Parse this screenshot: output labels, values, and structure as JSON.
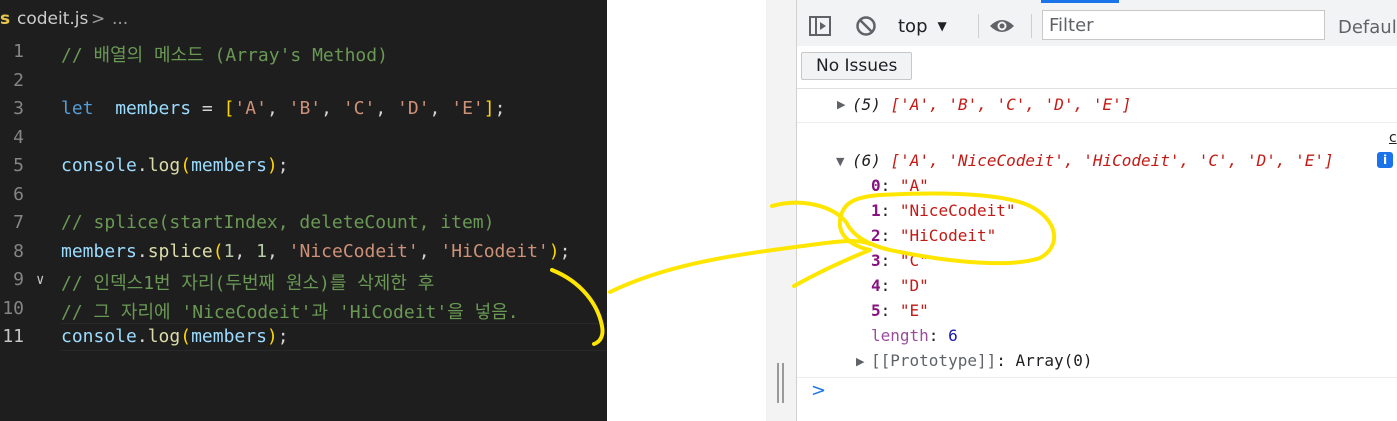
{
  "editor": {
    "tab_icon": "JS",
    "tab_file": "codeit.js",
    "tab_separator": ">",
    "tab_more": "...",
    "lines": [
      {
        "number": "1",
        "tokens": [
          [
            "cm",
            "// 배열의 메소드 (Array's Method)"
          ]
        ]
      },
      {
        "number": "2",
        "tokens": []
      },
      {
        "number": "3",
        "tokens": [
          [
            "kw",
            "let"
          ],
          [
            "",
            "  "
          ],
          [
            "vr",
            "members"
          ],
          [
            "",
            " = "
          ],
          [
            "br1",
            "["
          ],
          [
            "st",
            "'A'"
          ],
          [
            ", "
          ],
          [
            "st",
            "'B'"
          ],
          [
            ", "
          ],
          [
            "st",
            "'C'"
          ],
          [
            ", "
          ],
          [
            "st",
            "'D'"
          ],
          [
            ", "
          ],
          [
            "st",
            "'E'"
          ],
          [
            "br1",
            "]"
          ],
          [
            "",
            ";"
          ]
        ]
      },
      {
        "number": "4",
        "tokens": []
      },
      {
        "number": "5",
        "tokens": [
          [
            "vr",
            "console"
          ],
          [
            "",
            "."
          ],
          [
            "fn",
            "log"
          ],
          [
            "br1",
            "("
          ],
          [
            "vr",
            "members"
          ],
          [
            "br1",
            ")"
          ],
          [
            "",
            ";"
          ]
        ]
      },
      {
        "number": "6",
        "tokens": []
      },
      {
        "number": "7",
        "tokens": [
          [
            "cm",
            "// splice(startIndex, deleteCount, item)"
          ]
        ]
      },
      {
        "number": "8",
        "tokens": [
          [
            "vr",
            "members"
          ],
          [
            "",
            "."
          ],
          [
            "fn",
            "splice"
          ],
          [
            "br1",
            "("
          ],
          [
            "nm",
            "1"
          ],
          [
            "",
            ", "
          ],
          [
            "nm",
            "1"
          ],
          [
            "",
            ", "
          ],
          [
            "st",
            "'NiceCodeit'"
          ],
          [
            "",
            ", "
          ],
          [
            "st",
            "'HiCodeit'"
          ],
          [
            "br1",
            ")"
          ],
          [
            "",
            ";"
          ]
        ]
      },
      {
        "number": "9",
        "tokens": [
          [
            "cm",
            "// 인덱스1번 자리(두번째 원소)를 삭제한 후"
          ]
        ]
      },
      {
        "number": "10",
        "tokens": [
          [
            "cm",
            "// 그 자리에 'NiceCodeit'과 'HiCodeit'을 넣음."
          ]
        ]
      },
      {
        "number": "11",
        "tokens": [
          [
            "vr",
            "console"
          ],
          [
            "",
            "."
          ],
          [
            "fn",
            "log"
          ],
          [
            "br1",
            "("
          ],
          [
            "vr",
            "members"
          ],
          [
            "br1",
            ")"
          ],
          [
            "",
            ";"
          ]
        ]
      }
    ]
  },
  "devtools": {
    "context": "top",
    "filter_placeholder": "Filter",
    "levels": "Default",
    "issues_label": "No Issues",
    "source_link": "c",
    "info_badge": "i",
    "prompt": ">",
    "log1": {
      "count": "(5)",
      "array": "['A', 'B', 'C', 'D', 'E']"
    },
    "log2": {
      "count": "(6)",
      "array": "['A', 'NiceCodeit', 'HiCodeit', 'C', 'D', 'E']",
      "entries": [
        {
          "key": "0",
          "value": "\"A\""
        },
        {
          "key": "1",
          "value": "\"NiceCodeit\""
        },
        {
          "key": "2",
          "value": "\"HiCodeit\""
        },
        {
          "key": "3",
          "value": "\"C\""
        },
        {
          "key": "4",
          "value": "\"D\""
        },
        {
          "key": "5",
          "value": "\"E\""
        }
      ],
      "length_key": "length",
      "length_value": "6",
      "prototype_key": "[[Prototype]]",
      "prototype_value": "Array(0)"
    }
  },
  "colors": {
    "editor_bg": "#1e1e1e",
    "annotation": "#ffe600",
    "console_string": "#c41a16"
  }
}
